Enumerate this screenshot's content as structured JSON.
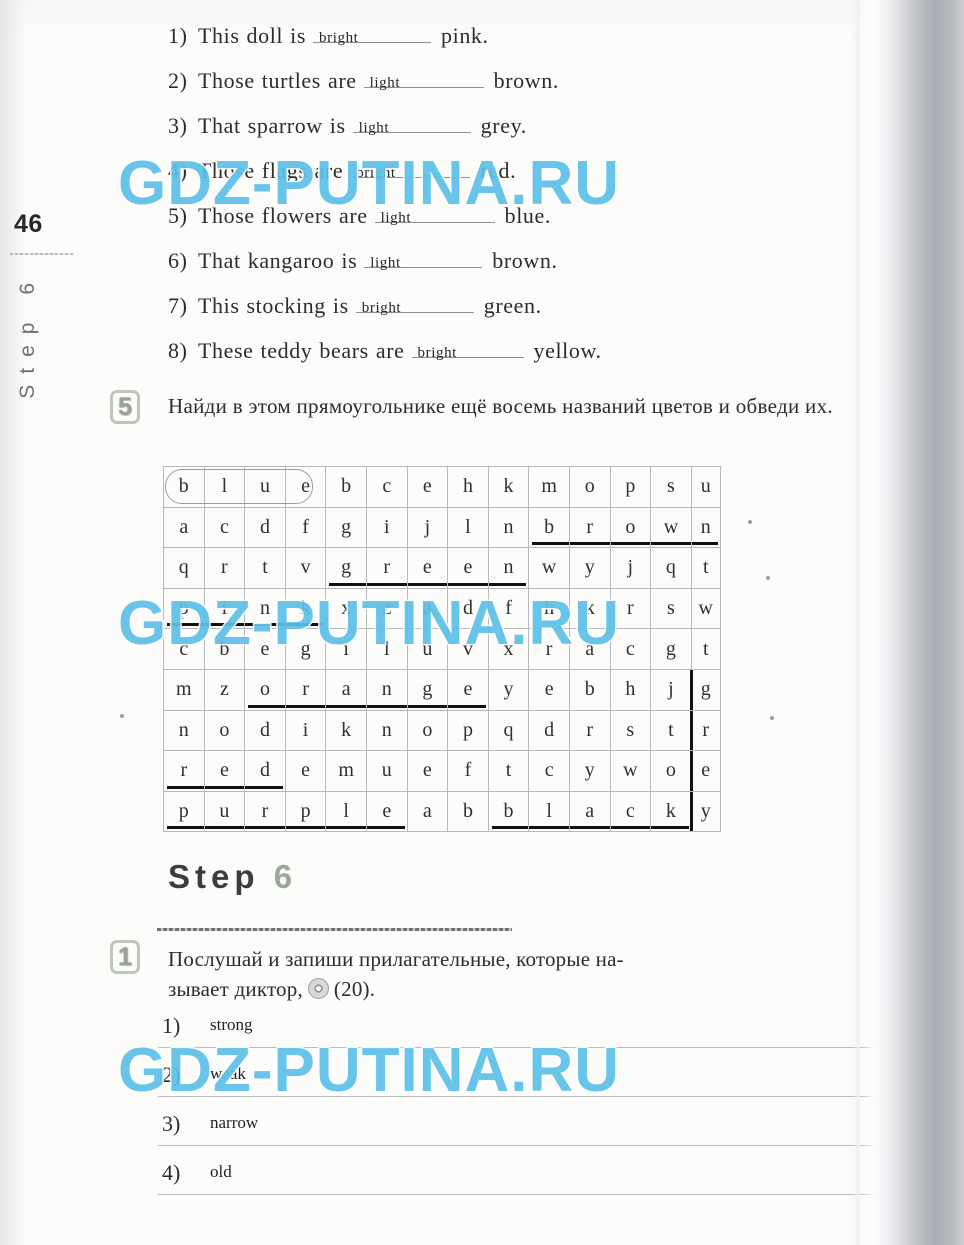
{
  "page": {
    "number": "46",
    "side_label": "Step 6",
    "watermark": "GDZ-PUTINA.RU",
    "watermark_color": "#5cc0e8"
  },
  "sentences": {
    "items": [
      {
        "num": "1)",
        "pre": "This doll is",
        "answer": "bright",
        "tail": "pink.",
        "blank_width": 118
      },
      {
        "num": "2)",
        "pre": "Those turtles are",
        "answer": "light",
        "tail": "brown.",
        "blank_width": 120
      },
      {
        "num": "3)",
        "pre": "That sparrow is",
        "answer": "light",
        "tail": "grey.",
        "blank_width": 118
      },
      {
        "num": "4)",
        "pre": "Those flags are",
        "answer": "bright",
        "tail": "red.",
        "blank_width": 120
      },
      {
        "num": "5)",
        "pre": "Those flowers are",
        "answer": "light",
        "tail": "blue.",
        "blank_width": 120
      },
      {
        "num": "6)",
        "pre": "That kangaroo is",
        "answer": "light",
        "tail": "brown.",
        "blank_width": 118
      },
      {
        "num": "7)",
        "pre": "This stocking is",
        "answer": "bright",
        "tail": "green.",
        "blank_width": 118
      },
      {
        "num": "8)",
        "pre": "These teddy bears are",
        "answer": "bright",
        "tail": "yellow.",
        "blank_width": 112
      }
    ]
  },
  "task5": {
    "badge": "5",
    "instruction": "Найди в этом прямоугольнике ещё восемь названий цветов и обведи их."
  },
  "wordsearch": {
    "rows": [
      [
        "b",
        "l",
        "u",
        "e",
        "b",
        "c",
        "e",
        "h",
        "k",
        "m",
        "o",
        "p",
        "s",
        "u"
      ],
      [
        "a",
        "c",
        "d",
        "f",
        "g",
        "i",
        "j",
        "l",
        "n",
        "b",
        "r",
        "o",
        "w",
        "n"
      ],
      [
        "q",
        "r",
        "t",
        "v",
        "g",
        "r",
        "e",
        "e",
        "n",
        "w",
        "y",
        "j",
        "q",
        "t"
      ],
      [
        "p",
        "i",
        "n",
        "k",
        "x",
        "z",
        "a",
        "d",
        "f",
        "h",
        "k",
        "r",
        "s",
        "w"
      ],
      [
        "c",
        "b",
        "e",
        "g",
        "i",
        "l",
        "u",
        "v",
        "x",
        "r",
        "a",
        "c",
        "g",
        "t"
      ],
      [
        "m",
        "z",
        "o",
        "r",
        "a",
        "n",
        "g",
        "e",
        "y",
        "e",
        "b",
        "h",
        "j",
        "g"
      ],
      [
        "n",
        "o",
        "d",
        "i",
        "k",
        "n",
        "o",
        "p",
        "q",
        "d",
        "r",
        "s",
        "t",
        "r"
      ],
      [
        "r",
        "e",
        "d",
        "e",
        "m",
        "u",
        "e",
        "f",
        "t",
        "c",
        "y",
        "w",
        "o",
        "e"
      ],
      [
        "p",
        "u",
        "r",
        "p",
        "l",
        "e",
        "a",
        "b",
        "b",
        "l",
        "a",
        "c",
        "k",
        "y"
      ]
    ],
    "found_words": [
      {
        "word": "blue",
        "style": "circled",
        "row": 0,
        "col_start": 0,
        "col_end": 3
      },
      {
        "word": "brown",
        "style": "underlined",
        "row": 1,
        "col_start": 9,
        "col_end": 13
      },
      {
        "word": "green",
        "style": "underlined",
        "row": 2,
        "col_start": 4,
        "col_end": 8
      },
      {
        "word": "pink",
        "style": "underlined",
        "row": 3,
        "col_start": 0,
        "col_end": 3
      },
      {
        "word": "orange",
        "style": "underlined",
        "row": 5,
        "col_start": 2,
        "col_end": 7
      },
      {
        "word": "red",
        "style": "underlined",
        "row": 7,
        "col_start": 0,
        "col_end": 2
      },
      {
        "word": "purple",
        "style": "underlined",
        "row": 8,
        "col_start": 0,
        "col_end": 5
      },
      {
        "word": "black",
        "style": "underlined",
        "row": 8,
        "col_start": 8,
        "col_end": 12
      },
      {
        "word": "grey",
        "style": "vertical",
        "col": 13,
        "row_start": 5,
        "row_end": 8
      }
    ]
  },
  "step6": {
    "word": "Step",
    "number": "6"
  },
  "task1": {
    "badge": "1",
    "instruction_part1": "Послушай и запиши прилагательные, которые на-",
    "instruction_part2": "зывает диктор,",
    "audio_ref": "(20).",
    "audio_icon": "cd-icon"
  },
  "answers": {
    "items": [
      {
        "num": "1)",
        "value": "strong"
      },
      {
        "num": "2)",
        "value": "weak"
      },
      {
        "num": "3)",
        "value": "narrow"
      },
      {
        "num": "4)",
        "value": "old"
      }
    ]
  }
}
